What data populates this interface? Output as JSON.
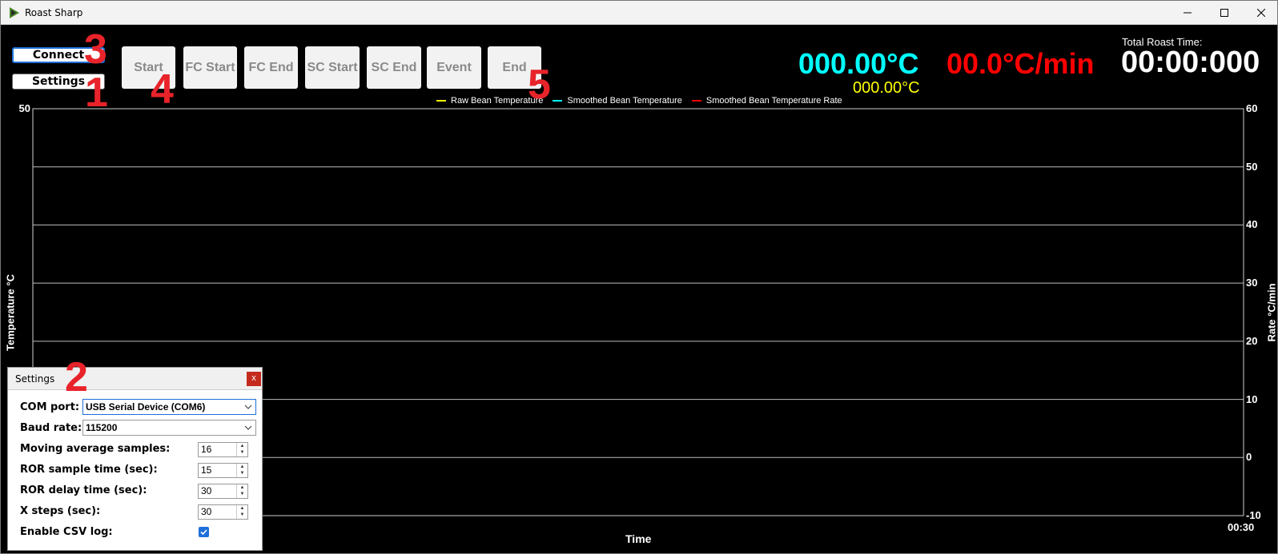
{
  "window": {
    "title": "Roast Sharp"
  },
  "controls": {
    "connect_label": "Connect",
    "settings_label": "Settings"
  },
  "event_buttons": {
    "start": "Start",
    "fc_start": "FC Start",
    "fc_end": "FC End",
    "sc_start": "SC Start",
    "sc_end": "SC End",
    "event": "Event",
    "end": "End"
  },
  "annotations": {
    "n1": "1",
    "n2": "2",
    "n3": "3",
    "n4": "4",
    "n5": "5"
  },
  "readouts": {
    "bean_temp": "000.00°C",
    "raw_temp": "000.00°C",
    "ror": "00.0°C/min",
    "roast_time_label": "Total Roast Time:",
    "roast_time": "00:00:000"
  },
  "colors": {
    "smoothed_temp": "#00ffff",
    "raw_temp": "#ffff00",
    "rate": "#ff0000",
    "annotation": "#e8232a",
    "accent": "#1e6fd9"
  },
  "chart_data": {
    "type": "line",
    "xlabel": "Time",
    "ylabel": "Temperature °C",
    "y2label": "Rate °C/min",
    "x_tick_labels": [
      "00:30"
    ],
    "left_ticks": [
      "50"
    ],
    "right_ticks": [
      "60",
      "50",
      "40",
      "30",
      "20",
      "10",
      "0",
      "-10"
    ],
    "ylim": [
      -10,
      60
    ],
    "grid": true,
    "legend_position": "top-center",
    "series": [
      {
        "name": "Raw Bean Temperature",
        "color": "#ffff00",
        "values": []
      },
      {
        "name": "Smoothed Bean Temperature",
        "color": "#00ffff",
        "values": []
      },
      {
        "name": "Smoothed Bean Temperature Rate",
        "color": "#ff0000",
        "values": []
      }
    ]
  },
  "settings_dialog": {
    "title": "Settings",
    "close_label": "x",
    "com_port_label": "COM port:",
    "com_port_value": "USB Serial Device (COM6)",
    "baud_rate_label": "Baud rate:",
    "baud_rate_value": "115200",
    "moving_avg_label": "Moving average samples:",
    "moving_avg_value": "16",
    "ror_sample_label": "ROR sample time (sec):",
    "ror_sample_value": "15",
    "ror_delay_label": "ROR delay time (sec):",
    "ror_delay_value": "30",
    "x_steps_label": "X steps (sec):",
    "x_steps_value": "30",
    "csv_label": "Enable CSV log:",
    "csv_enabled": true
  }
}
